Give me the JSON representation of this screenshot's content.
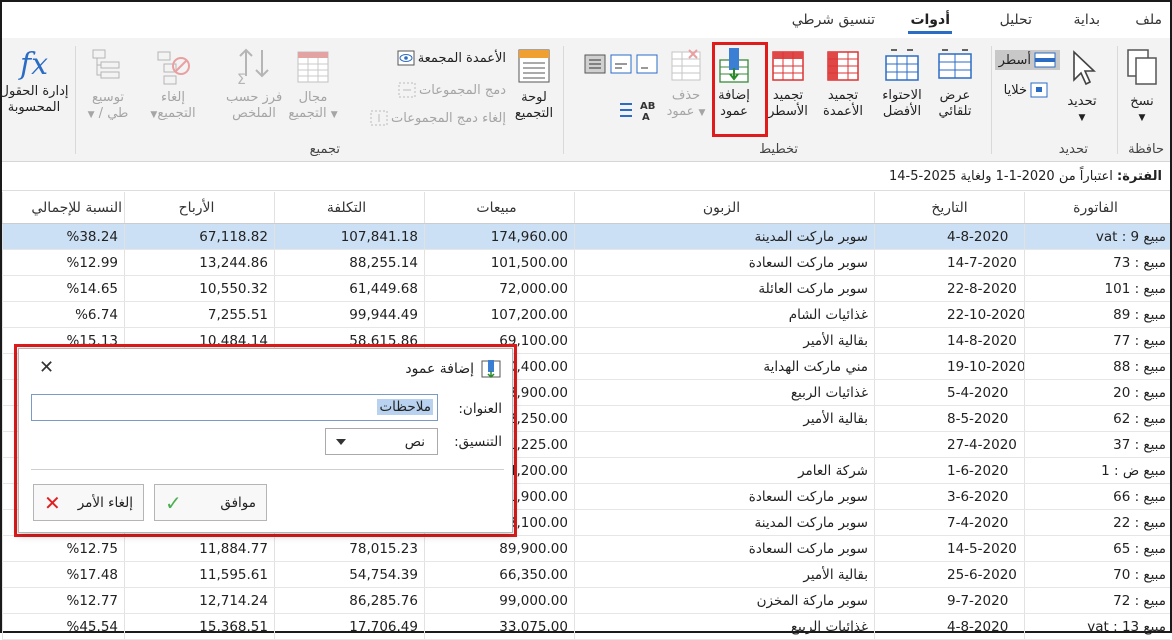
{
  "tabs": [
    "ملف",
    "بداية",
    "تحليل",
    "أدوات",
    "تنسيق شرطي"
  ],
  "ribbon": {
    "paste": "نسخ",
    "select": "تحديد",
    "rows": "أسطر",
    "cells": "خلايا",
    "autofit": [
      "عرض",
      "تلقائي"
    ],
    "bestfit": [
      "الاحتواء",
      "الأفضل"
    ],
    "freeze_cols": [
      "تجميد",
      "الأعمدة"
    ],
    "freeze_rows": [
      "تجميد",
      "الأسطر"
    ],
    "add_column": [
      "إضافة",
      "عمود"
    ],
    "delete_column": [
      "حذف",
      "عمود"
    ],
    "group_panel": [
      "لوحة",
      "التجميع"
    ],
    "grouped_columns": "الأعمدة المجمعة",
    "merge_groups": "دمج المجموعات",
    "unmerge_groups": "إلغاء دمج المجموعات",
    "group_range": [
      "مجال",
      "التجميع"
    ],
    "sort_summary": [
      "فرز حسب",
      "الملخص"
    ],
    "ungroup": [
      "إلغاء",
      "التجميع"
    ],
    "expand": [
      "توسيع",
      "/ طي"
    ],
    "calc_fields": [
      "إدارة الحقول",
      "المحسوبة"
    ],
    "groups": {
      "clipboard": "حافظة",
      "selection": "تحديد",
      "layout": "تخطيط",
      "grouping": "تجميع"
    }
  },
  "period": {
    "label": "الفترة:",
    "text": "اعتباراً من 2020-1-1 ولغاية 2025-5-14"
  },
  "grid": {
    "headers": {
      "invoice": "الفاتورة",
      "date": "التاريخ",
      "customer": "الزبون",
      "sales": "مبيعات",
      "cost": "التكلفة",
      "profit": "الأرباح",
      "pct": "النسبة للإجمالي"
    },
    "rows": [
      {
        "invoice": "مبيع 9 : vat",
        "date": "4-8-2020",
        "customer": "سوبر ماركت المدينة",
        "sales": "174,960.00",
        "cost": "107,841.18",
        "profit": "67,118.82",
        "pct": "%38.24"
      },
      {
        "invoice": "مبيع : 73",
        "date": "14-7-2020",
        "customer": "سوبر ماركت السعادة",
        "sales": "101,500.00",
        "cost": "88,255.14",
        "profit": "13,244.86",
        "pct": "%12.99"
      },
      {
        "invoice": "مبيع : 101",
        "date": "22-8-2020",
        "customer": "سوبر ماركت العائلة",
        "sales": "72,000.00",
        "cost": "61,449.68",
        "profit": "10,550.32",
        "pct": "%14.65"
      },
      {
        "invoice": "مبيع : 89",
        "date": "22-10-2020",
        "customer": "غذائيات الشام",
        "sales": "107,200.00",
        "cost": "99,944.49",
        "profit": "7,255.51",
        "pct": "%6.74"
      },
      {
        "invoice": "مبيع : 77",
        "date": "14-8-2020",
        "customer": "بقالية الأمير",
        "sales": "69,100.00",
        "cost": "58,615.86",
        "profit": "10,484.14",
        "pct": "%15.13"
      },
      {
        "invoice": "مبيع : 88",
        "date": "19-10-2020",
        "customer": "مني ماركت الهداية",
        "sales": "60,400.00",
        "cost": "",
        "profit": "",
        "pct": ""
      },
      {
        "invoice": "مبيع : 20",
        "date": "5-4-2020",
        "customer": "غذائيات الربيع",
        "sales": "63,900.00",
        "cost": "",
        "profit": "",
        "pct": ""
      },
      {
        "invoice": "مبيع : 62",
        "date": "8-5-2020",
        "customer": "بقالية الأمير",
        "sales": "22,250.00",
        "cost": "",
        "profit": "",
        "pct": ""
      },
      {
        "invoice": "مبيع : 37",
        "date": "27-4-2020",
        "customer": "",
        "sales": "11,225.00",
        "cost": "",
        "profit": "",
        "pct": ""
      },
      {
        "invoice": "مبيع ض : 1",
        "date": "1-6-2020",
        "customer": "شركة العامر",
        "sales": "24,200.00",
        "cost": "",
        "profit": "",
        "pct": ""
      },
      {
        "invoice": "مبيع : 66",
        "date": "3-6-2020",
        "customer": "سوبر ماركت السعادة",
        "sales": "31,900.00",
        "cost": "",
        "profit": "",
        "pct": ""
      },
      {
        "invoice": "مبيع : 22",
        "date": "7-4-2020",
        "customer": "سوبر ماركت المدينة",
        "sales": "43,100.00",
        "cost": "",
        "profit": "",
        "pct": ""
      },
      {
        "invoice": "مبيع : 65",
        "date": "14-5-2020",
        "customer": "سوبر ماركت السعادة",
        "sales": "89,900.00",
        "cost": "78,015.23",
        "profit": "11,884.77",
        "pct": "%12.75"
      },
      {
        "invoice": "مبيع : 70",
        "date": "25-6-2020",
        "customer": "بقالية الأمير",
        "sales": "66,350.00",
        "cost": "54,754.39",
        "profit": "11,595.61",
        "pct": "%17.48"
      },
      {
        "invoice": "مبيع : 72",
        "date": "9-7-2020",
        "customer": "سوبر ماركة المخزن",
        "sales": "99,000.00",
        "cost": "86,285.76",
        "profit": "12,714.24",
        "pct": "%12.77"
      },
      {
        "invoice": "مبيع 13 : vat",
        "date": "4-8-2020",
        "customer": "غذائيات الربيع",
        "sales": "33,075.00",
        "cost": "17,706.49",
        "profit": "15,368.51",
        "pct": "%45.54"
      }
    ]
  },
  "dialog": {
    "title": "إضافة عمود",
    "title_label": "العنوان:",
    "title_value": "ملاحظات",
    "format_label": "التنسيق:",
    "format_value": "نص",
    "ok": "موافق",
    "cancel": "إلغاء الأمر"
  },
  "colors": {
    "accent": "#2b6cc4",
    "highlight": "#e01b1b",
    "selected_row": "#cce0f5"
  }
}
